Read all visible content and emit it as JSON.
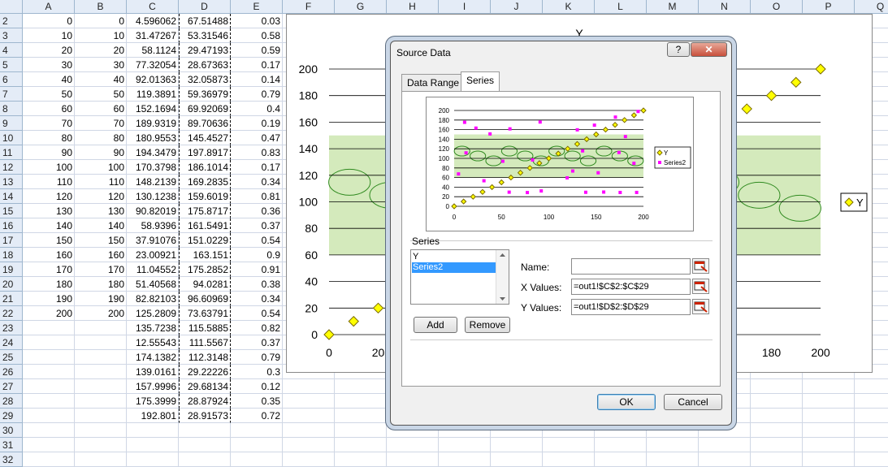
{
  "columns": [
    "A",
    "B",
    "C",
    "D",
    "E",
    "F",
    "G",
    "H",
    "I",
    "J",
    "K",
    "L",
    "M",
    "N",
    "O",
    "P",
    "Q"
  ],
  "rows": [
    {
      "num": "2",
      "a": "0",
      "b": "0",
      "c": "4.596062",
      "d": "67.51488",
      "e": "0.03"
    },
    {
      "num": "3",
      "a": "10",
      "b": "10",
      "c": "31.47267",
      "d": "53.31546",
      "e": "0.58"
    },
    {
      "num": "4",
      "a": "20",
      "b": "20",
      "c": "58.1124",
      "d": "29.47193",
      "e": "0.59"
    },
    {
      "num": "5",
      "a": "30",
      "b": "30",
      "c": "77.32054",
      "d": "28.67363",
      "e": "0.17"
    },
    {
      "num": "6",
      "a": "40",
      "b": "40",
      "c": "92.01363",
      "d": "32.05873",
      "e": "0.14"
    },
    {
      "num": "7",
      "a": "50",
      "b": "50",
      "c": "119.3891",
      "d": "59.36979",
      "e": "0.79"
    },
    {
      "num": "8",
      "a": "60",
      "b": "60",
      "c": "152.1694",
      "d": "69.92069",
      "e": "0.4"
    },
    {
      "num": "9",
      "a": "70",
      "b": "70",
      "c": "189.9319",
      "d": "89.70636",
      "e": "0.19"
    },
    {
      "num": "10",
      "a": "80",
      "b": "80",
      "c": "180.9553",
      "d": "145.4527",
      "e": "0.47"
    },
    {
      "num": "11",
      "a": "90",
      "b": "90",
      "c": "194.3479",
      "d": "197.8917",
      "e": "0.83"
    },
    {
      "num": "12",
      "a": "100",
      "b": "100",
      "c": "170.3798",
      "d": "186.1014",
      "e": "0.17"
    },
    {
      "num": "13",
      "a": "110",
      "b": "110",
      "c": "148.2139",
      "d": "169.2835",
      "e": "0.34"
    },
    {
      "num": "14",
      "a": "120",
      "b": "120",
      "c": "130.1238",
      "d": "159.6019",
      "e": "0.81"
    },
    {
      "num": "15",
      "a": "130",
      "b": "130",
      "c": "90.82019",
      "d": "175.8717",
      "e": "0.36"
    },
    {
      "num": "16",
      "a": "140",
      "b": "140",
      "c": "58.9396",
      "d": "161.5491",
      "e": "0.37"
    },
    {
      "num": "17",
      "a": "150",
      "b": "150",
      "c": "37.91076",
      "d": "151.0229",
      "e": "0.54"
    },
    {
      "num": "18",
      "a": "160",
      "b": "160",
      "c": "23.00921",
      "d": "163.151",
      "e": "0.9"
    },
    {
      "num": "19",
      "a": "170",
      "b": "170",
      "c": "11.04552",
      "d": "175.2852",
      "e": "0.91"
    },
    {
      "num": "20",
      "a": "180",
      "b": "180",
      "c": "51.40568",
      "d": "94.0281",
      "e": "0.38"
    },
    {
      "num": "21",
      "a": "190",
      "b": "190",
      "c": "82.82103",
      "d": "96.60969",
      "e": "0.34"
    },
    {
      "num": "22",
      "a": "200",
      "b": "200",
      "c": "125.2809",
      "d": "73.63791",
      "e": "0.54"
    },
    {
      "num": "23",
      "a": "",
      "b": "",
      "c": "135.7238",
      "d": "115.5885",
      "e": "0.82"
    },
    {
      "num": "24",
      "a": "",
      "b": "",
      "c": "12.55543",
      "d": "111.5567",
      "e": "0.37"
    },
    {
      "num": "25",
      "a": "",
      "b": "",
      "c": "174.1382",
      "d": "112.3148",
      "e": "0.79"
    },
    {
      "num": "26",
      "a": "",
      "b": "",
      "c": "139.0161",
      "d": "29.22226",
      "e": "0.3"
    },
    {
      "num": "27",
      "a": "",
      "b": "",
      "c": "157.9996",
      "d": "29.68134",
      "e": "0.12"
    },
    {
      "num": "28",
      "a": "",
      "b": "",
      "c": "175.3999",
      "d": "28.87924",
      "e": "0.35"
    },
    {
      "num": "29",
      "a": "",
      "b": "",
      "c": "192.801",
      "d": "28.91573",
      "e": "0.72"
    },
    {
      "num": "30",
      "a": "",
      "b": "",
      "c": "",
      "d": "",
      "e": ""
    },
    {
      "num": "31",
      "a": "",
      "b": "",
      "c": "",
      "d": "",
      "e": ""
    },
    {
      "num": "32",
      "a": "",
      "b": "",
      "c": "",
      "d": "",
      "e": ""
    }
  ],
  "chart": {
    "title": "Y",
    "legend": "Y",
    "y_ticks": [
      "200",
      "180",
      "160",
      "140",
      "120",
      "100",
      "80",
      "60",
      "40",
      "20",
      "0"
    ],
    "x_ticks_visible": [
      "0",
      "20",
      "180",
      "200"
    ]
  },
  "chart_data": {
    "type": "scatter",
    "title": "Y",
    "xlim": [
      0,
      200
    ],
    "ylim": [
      0,
      200
    ],
    "legend_placement": "right",
    "series": [
      {
        "name": "Y",
        "color": "#ffff00",
        "x": [
          0,
          10,
          20,
          30,
          40,
          50,
          60,
          70,
          80,
          90,
          100,
          110,
          120,
          130,
          140,
          150,
          160,
          170,
          180,
          190,
          200
        ],
        "y": [
          0,
          10,
          20,
          30,
          40,
          50,
          60,
          70,
          80,
          90,
          100,
          110,
          120,
          130,
          140,
          150,
          160,
          170,
          180,
          190,
          200
        ]
      },
      {
        "name": "Series2",
        "color": "#ff00ff",
        "x": [
          4.596062,
          31.47267,
          58.1124,
          77.32054,
          92.01363,
          119.3891,
          152.1694,
          189.9319,
          180.9553,
          194.3479,
          170.3798,
          148.2139,
          130.1238,
          90.82019,
          58.9396,
          37.91076,
          23.00921,
          11.04552,
          51.40568,
          82.82103,
          125.2809,
          135.7238,
          12.55543,
          174.1382,
          139.0161,
          157.9996,
          175.3999,
          192.801
        ],
        "y": [
          67.51488,
          53.31546,
          29.47193,
          28.67363,
          32.05873,
          59.36979,
          69.92069,
          89.70636,
          145.4527,
          197.8917,
          186.1014,
          169.2835,
          159.6019,
          175.8717,
          161.5491,
          151.0229,
          163.151,
          175.2852,
          94.0281,
          96.60969,
          73.63791,
          115.5885,
          111.5567,
          112.3148,
          29.22226,
          29.68134,
          28.87924,
          28.91573
        ]
      }
    ]
  },
  "dialog": {
    "title": "Source Data",
    "help": "?",
    "close": "✕",
    "tabs": [
      "Data Range",
      "Series"
    ],
    "preview": {
      "y_ticks": [
        "200",
        "180",
        "160",
        "140",
        "120",
        "100",
        "80",
        "60",
        "40",
        "20",
        "0"
      ],
      "x_ticks": [
        "0",
        "50",
        "100",
        "150",
        "200"
      ],
      "legend": [
        "Y",
        "Series2"
      ]
    },
    "series_label": "Series",
    "series_items": [
      "Y",
      "Series2"
    ],
    "selected_index": 1,
    "add_label": "Add",
    "remove_label": "Remove",
    "name_label": "Name:",
    "name_value": "",
    "xvalues_label": "X Values:",
    "xvalues_value": "=out1!$C$2:$C$29",
    "yvalues_label": "Y Values:",
    "yvalues_value": "=out1!$D$2:$D$29",
    "ok_label": "OK",
    "cancel_label": "Cancel"
  }
}
